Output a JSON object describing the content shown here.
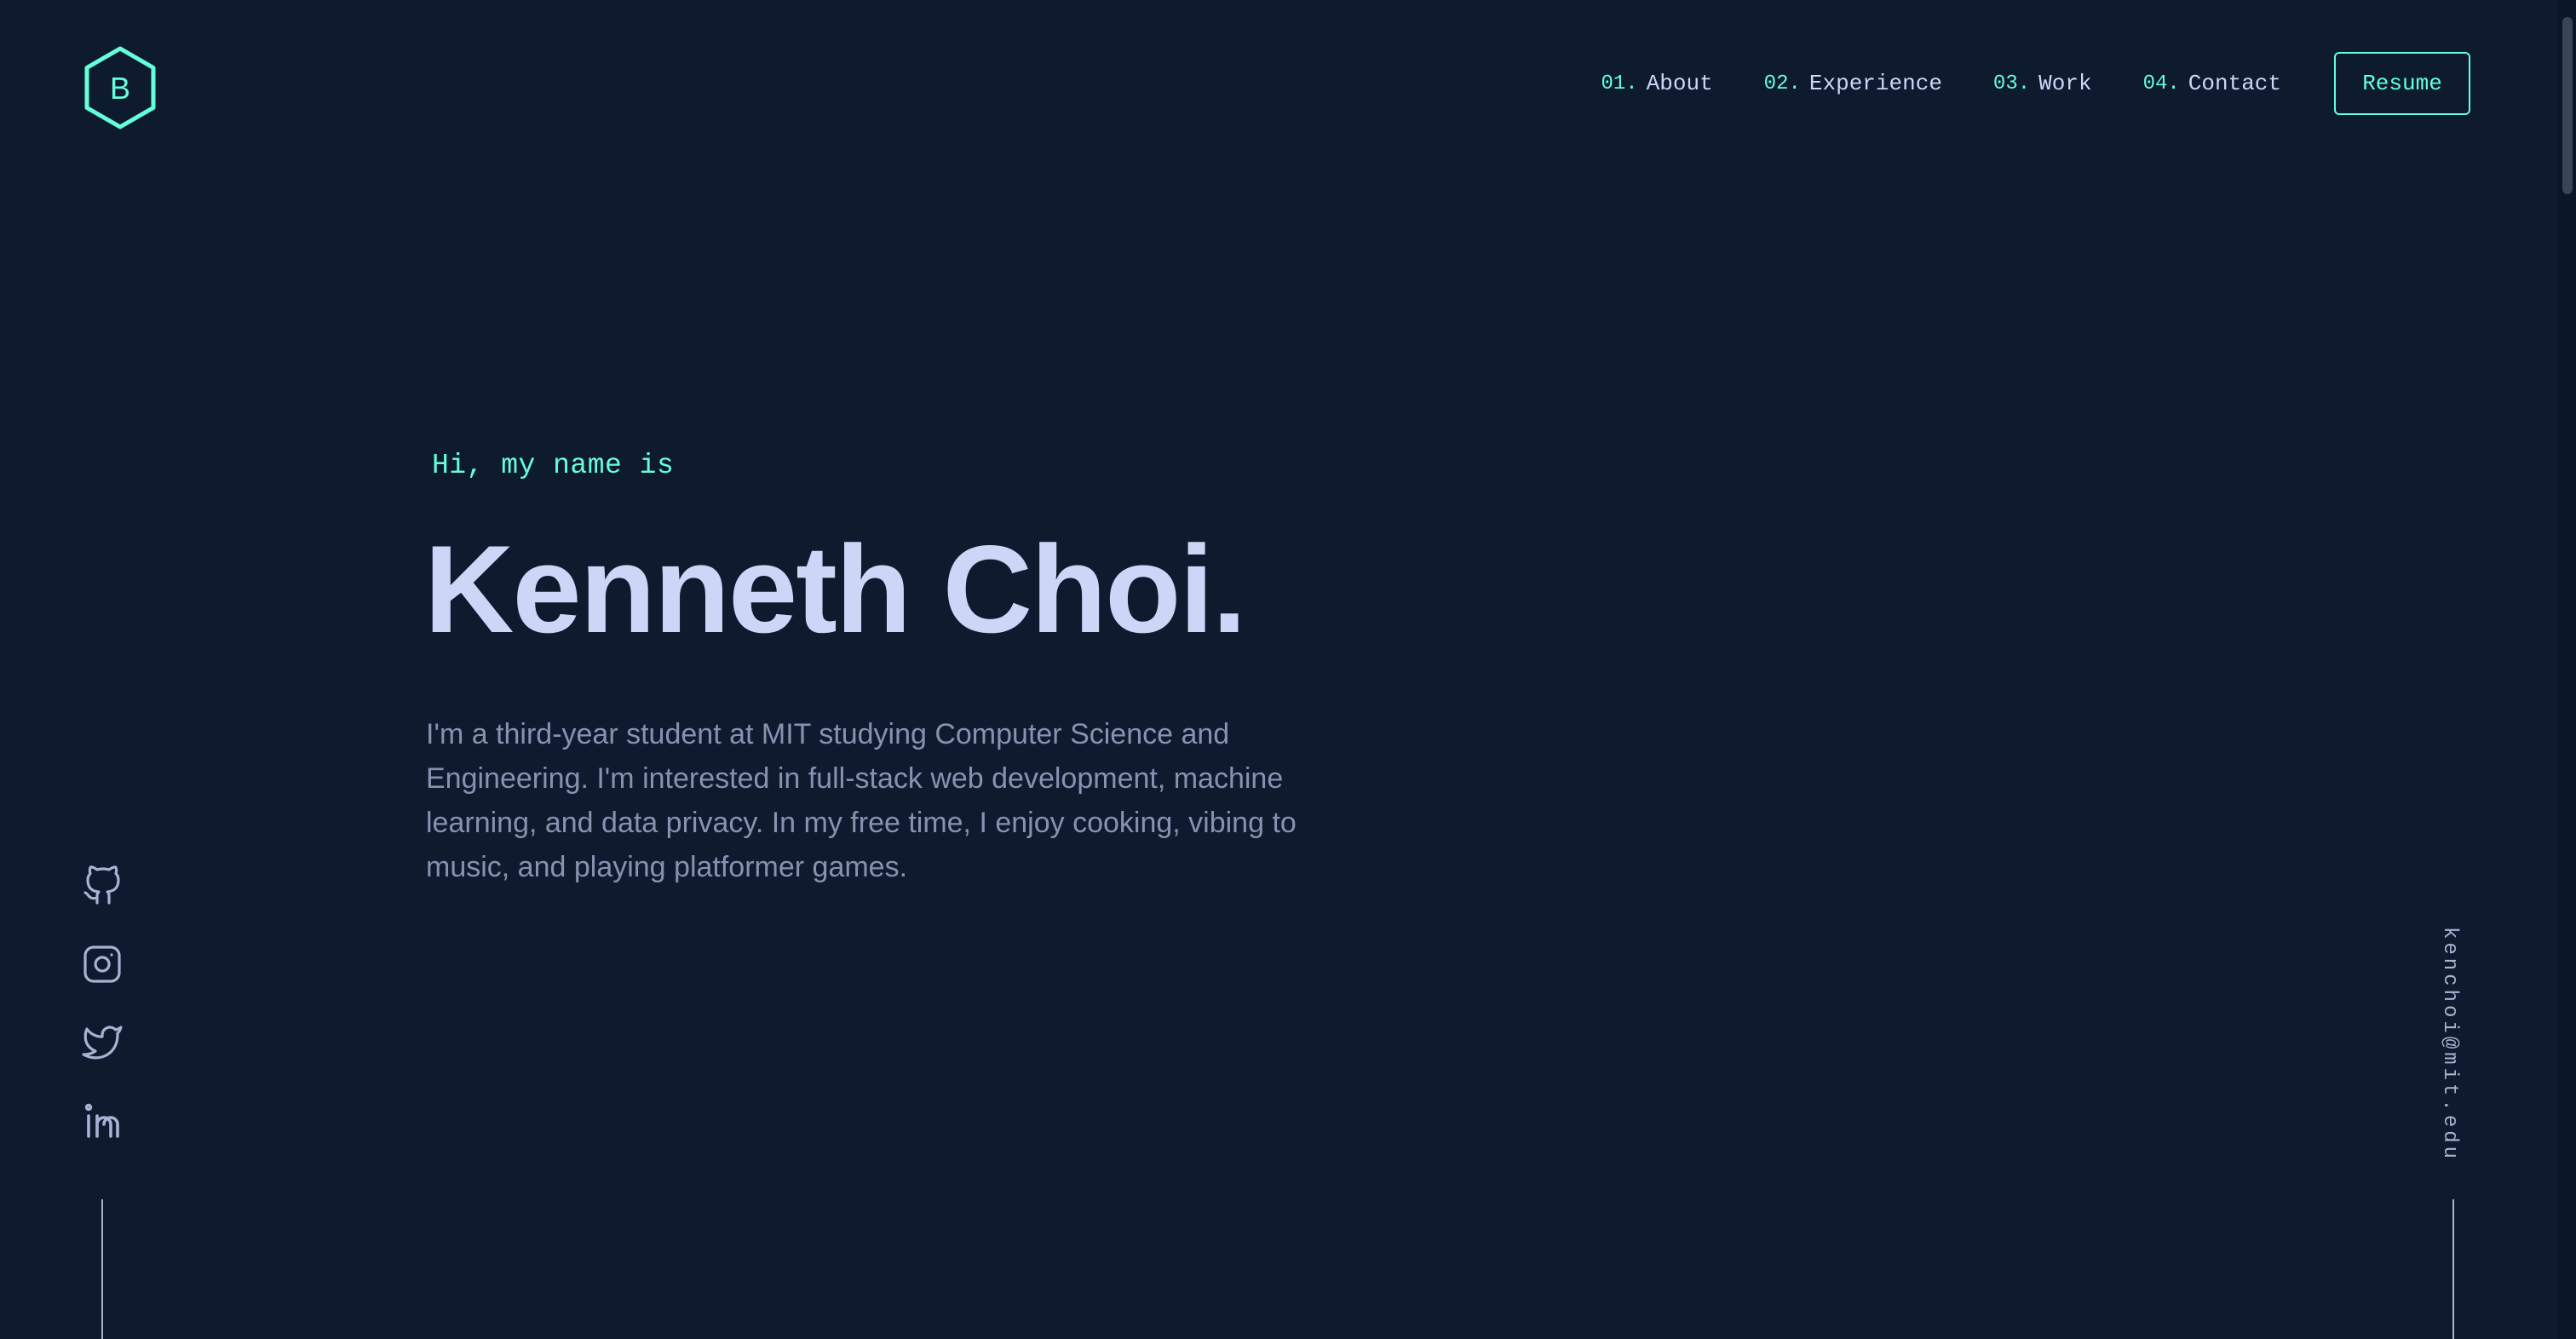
{
  "logo": {
    "letter": "B",
    "icon": "hexagon-logo-icon",
    "color": "#64ffda"
  },
  "nav": {
    "items": [
      {
        "num": "01.",
        "label": "About"
      },
      {
        "num": "02.",
        "label": "Experience"
      },
      {
        "num": "03.",
        "label": "Work"
      },
      {
        "num": "04.",
        "label": "Contact"
      }
    ],
    "resume_label": "Resume"
  },
  "hero": {
    "greeting": "Hi, my name is",
    "name": "Kenneth Choi.",
    "bio": "I'm a third-year student at MIT studying Computer Science and Engineering. I'm interested in full-stack web development, machine learning, and data privacy. In my free time, I enjoy cooking, vibing to music, and playing platformer games."
  },
  "social": [
    {
      "name": "github",
      "icon": "github-icon"
    },
    {
      "name": "instagram",
      "icon": "instagram-icon"
    },
    {
      "name": "twitter",
      "icon": "twitter-icon"
    },
    {
      "name": "linkedin",
      "icon": "linkedin-icon"
    }
  ],
  "email": "kenchoi@mit.edu",
  "colors": {
    "background": "#0e1a2e",
    "accent": "#64ffda",
    "heading": "#ccd6f6",
    "body": "#8892b0",
    "light": "#a8b2d1"
  }
}
